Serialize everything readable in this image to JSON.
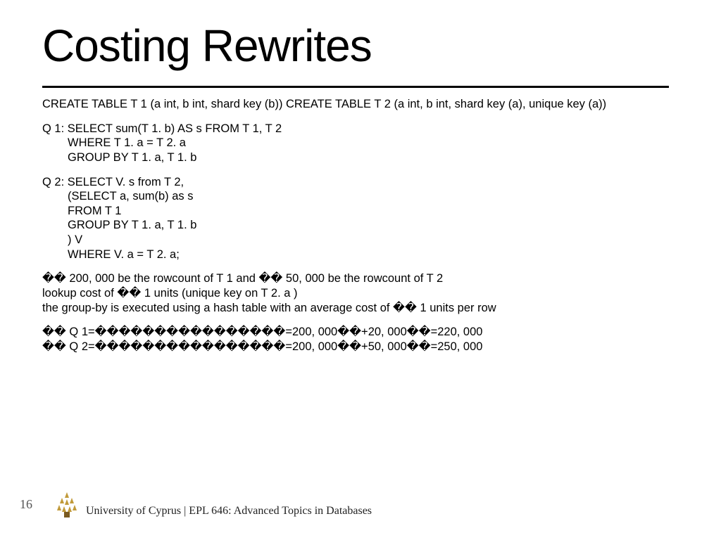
{
  "title": "Costing Rewrites",
  "ddl": "CREATE TABLE T 1 (a int, b int, shard key (b)) CREATE TABLE T 2 (a int, b int, shard key (a), unique key (a))",
  "q1_header": "Q 1: SELECT sum(T 1. b) AS s FROM T 1, T 2",
  "q1_l2": "WHERE T 1. a = T 2. a",
  "q1_l3": "GROUP BY T 1. a, T 1. b",
  "q2_header": "Q 2: SELECT V. s from T 2,",
  "q2_l2": "(SELECT a, sum(b) as s",
  "q2_l3": "FROM T 1",
  "q2_l4": "GROUP BY T 1. a, T 1. b",
  "q2_l5": ") V",
  "q2_l6": "WHERE V. a = T 2. a;",
  "assume_prefix": "�� 200, 000 be the rowcount of T 1 and �� 50, 000 be the rowcount of T 2",
  "lookup_line": "lookup cost of �� 1 units (unique key on T 2. a )",
  "groupby_line": "the group-by is executed using a hash table with an average cost of �� 1 units per row",
  "cost_q1": "�� Q 1=����������������=200, 000��+20, 000��=220, 000",
  "cost_q2": "�� Q 2=����������������=200, 000��+50, 000��=250, 000",
  "page_number": "16",
  "footer": "University of Cyprus | EPL 646: Advanced Topics in Databases"
}
